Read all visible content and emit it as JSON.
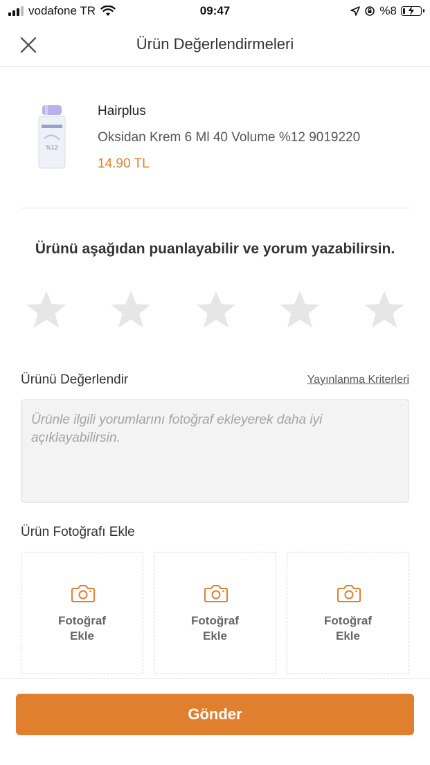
{
  "status_bar": {
    "carrier": "vodafone TR",
    "time": "09:47",
    "battery_text": "%8"
  },
  "header": {
    "title": "Ürün Değerlendirmeleri"
  },
  "product": {
    "brand": "Hairplus",
    "name": "Oksidan Krem 6 Ml 40 Volume %12 9019220",
    "price": "14.90 TL",
    "image_label": "%12"
  },
  "rating": {
    "prompt": "Ürünü aşağıdan puanlayabilir ve yorum yazabilirsin.",
    "max_stars": 5,
    "value": 0
  },
  "review": {
    "label": "Ürünü Değerlendir",
    "criteria_link": "Yayınlanma Kriterleri",
    "placeholder": "Ürünle ilgili yorumlarını fotoğraf ekleyerek daha iyi açıklayabilirsin."
  },
  "photos": {
    "label": "Ürün Fotoğrafı Ekle",
    "tiles": [
      {
        "line1": "Fotoğraf",
        "line2": "Ekle"
      },
      {
        "line1": "Fotoğraf",
        "line2": "Ekle"
      },
      {
        "line1": "Fotoğraf",
        "line2": "Ekle"
      }
    ]
  },
  "footer": {
    "submit_label": "Gönder"
  },
  "colors": {
    "accent": "#e0802f",
    "star_empty": "#e6e6e6"
  }
}
